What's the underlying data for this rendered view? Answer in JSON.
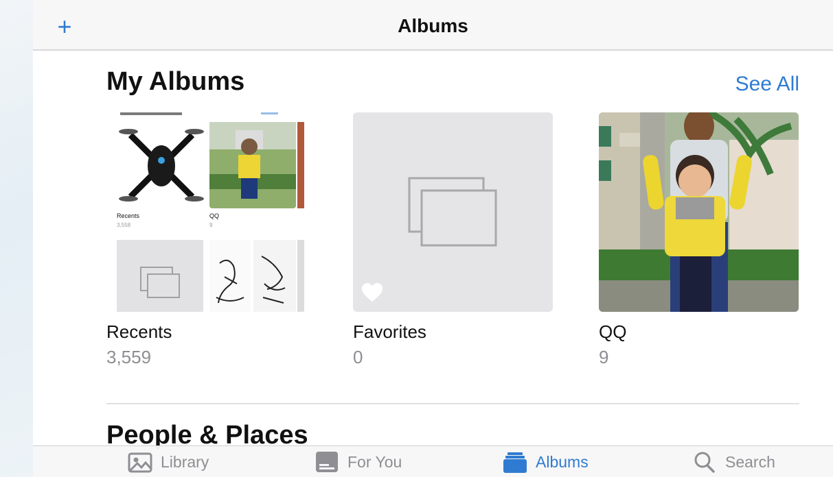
{
  "navbar": {
    "title": "Albums",
    "add_icon": "plus-icon"
  },
  "my_albums": {
    "title": "My Albums",
    "see_all": "See All",
    "albums": [
      {
        "name": "Recents",
        "count": "3,559"
      },
      {
        "name": "Favorites",
        "count": "0"
      },
      {
        "name": "QQ",
        "count": "9"
      }
    ],
    "preview": {
      "items": [
        {
          "name": "Recents",
          "count": "3,558"
        },
        {
          "name": "QQ",
          "count": "9"
        }
      ]
    }
  },
  "people_places": {
    "title": "People & Places"
  },
  "tabbar": {
    "tabs": [
      {
        "label": "Library",
        "icon": "photo-icon",
        "active": false
      },
      {
        "label": "For You",
        "icon": "for-you-icon",
        "active": false
      },
      {
        "label": "Albums",
        "icon": "albums-icon",
        "active": true
      },
      {
        "label": "Search",
        "icon": "search-icon",
        "active": false
      }
    ]
  },
  "colors": {
    "accent": "#2f7bd1",
    "secondary_text": "#8e8e93",
    "placeholder_bg": "#e5e5e7"
  }
}
